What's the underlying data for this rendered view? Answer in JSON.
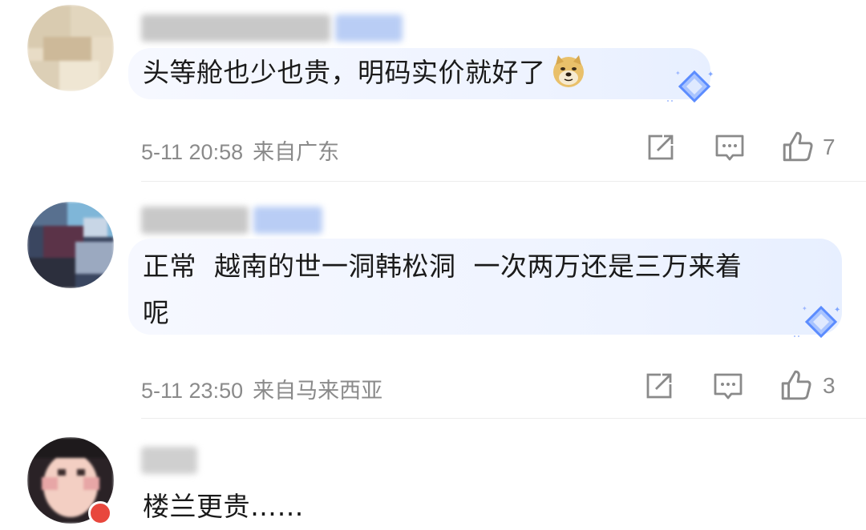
{
  "comments": [
    {
      "text": "头等舱也少也贵，明码实价就好了",
      "emoji_icon": "doge-emoji-icon",
      "time": "5-11 20:58",
      "location": "来自广东",
      "likes": "7"
    },
    {
      "text_line1": "正常  越南的世一洞韩松洞  一次两万还是三万来着",
      "text_line2": "呢",
      "time": "5-11 23:50",
      "location": "来自马来西亚",
      "likes": "3"
    },
    {
      "text": "楼兰更贵……"
    }
  ],
  "colors": {
    "meta_text": "#8a8a8a",
    "bubble": "#eef3ff",
    "gem": "#5b8cff"
  }
}
